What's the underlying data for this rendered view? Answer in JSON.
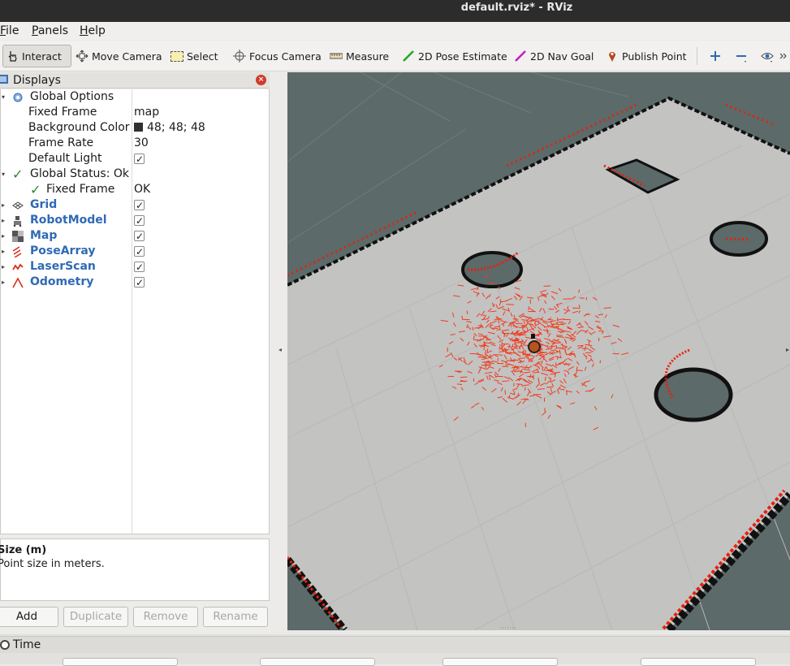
{
  "window": {
    "title": "default.rviz* - RViz"
  },
  "menubar": {
    "items": [
      {
        "label": "File",
        "key": "F",
        "rest": "ile"
      },
      {
        "label": "Panels",
        "key": "P",
        "rest": "anels"
      },
      {
        "label": "Help",
        "key": "H",
        "rest": "elp"
      }
    ]
  },
  "toolbar": {
    "interact": "Interact",
    "move_camera": "Move Camera",
    "select": "Select",
    "focus_camera": "Focus Camera",
    "measure": "Measure",
    "pose_estimate": "2D Pose Estimate",
    "nav_goal": "2D Nav Goal",
    "publish_point": "Publish Point"
  },
  "displays_panel": {
    "title": "Displays",
    "global_options": {
      "label": "Global Options",
      "fixed_frame_label": "Fixed Frame",
      "fixed_frame_value": "map",
      "bg_color_label": "Background Color",
      "bg_color_value": "48; 48; 48",
      "frame_rate_label": "Frame Rate",
      "frame_rate_value": "30",
      "default_light_label": "Default Light",
      "default_light_checked": true
    },
    "global_status": {
      "label": "Global Status: Ok",
      "fixed_frame_label": "Fixed Frame",
      "fixed_frame_value": "OK"
    },
    "displays": [
      {
        "name": "Grid",
        "enabled": true
      },
      {
        "name": "RobotModel",
        "enabled": true
      },
      {
        "name": "Map",
        "enabled": true
      },
      {
        "name": "PoseArray",
        "enabled": true
      },
      {
        "name": "LaserScan",
        "enabled": true
      },
      {
        "name": "Odometry",
        "enabled": true
      }
    ],
    "description": {
      "title": "Size (m)",
      "text": "Point size in meters."
    },
    "buttons": {
      "add": "Add",
      "duplicate": "Duplicate",
      "remove": "Remove",
      "rename": "Rename"
    }
  },
  "time_panel": {
    "title": "Time"
  },
  "colors": {
    "accent_blue": "#2f6ab5",
    "laser_red": "#e8200c",
    "pose_red": "#f03c1e",
    "floor": "#c3c3c2",
    "unknown": "#5c6a69"
  }
}
